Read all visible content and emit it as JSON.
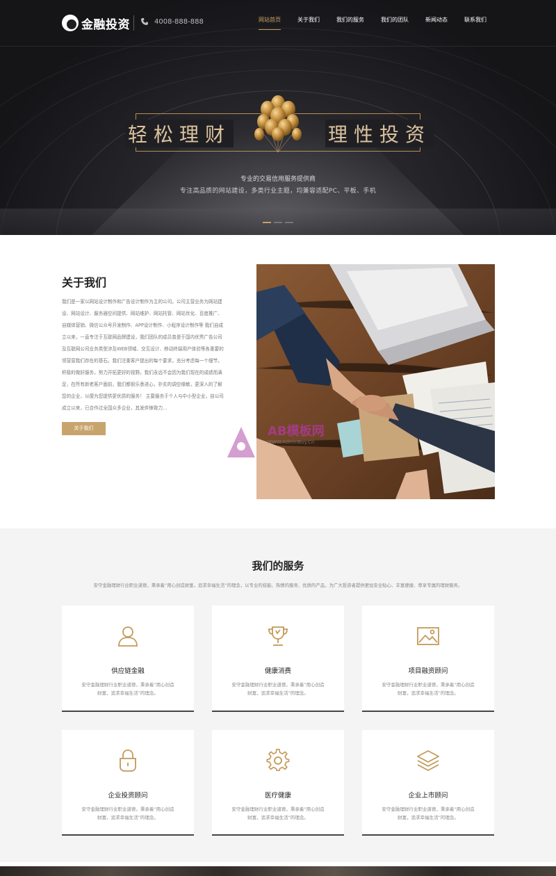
{
  "header": {
    "logo_text": "金融投资",
    "phone": "4008-888-888",
    "nav": [
      {
        "label": "网站首页",
        "active": true
      },
      {
        "label": "关于我们",
        "active": false
      },
      {
        "label": "我们的服务",
        "active": false
      },
      {
        "label": "我们的团队",
        "active": false
      },
      {
        "label": "新闻动态",
        "active": false
      },
      {
        "label": "联系我们",
        "active": false
      }
    ]
  },
  "hero": {
    "headline_left": "轻松理财",
    "headline_right": "理性投资",
    "sub1": "专业的交易信用服务提供商",
    "sub2": "专注高品质的网站建设，多类行业主题，均兼容适配PC、平板、手机",
    "slides": 3,
    "active_slide": 0
  },
  "about": {
    "title": "关于我们",
    "text": "我们是一家以网站设计制作和广告设计制作为主的公司。公司主营业务为网站建设、网站设计、服务器空间提供、网站维护、网站托管、网站优化、百度推广、自媒体营销、微信公众号开发制作、APP设计制作、小程序设计制作等 我们自成立以来，一直专注于互联网品牌建设，我们团队的成员曾是于国内优秀广告公司及互联网公司业务类型涉及WEB领域、交互设计、移动终端用户体验等各重要的领营营我们存在的基石。我们注重客户提出的每个要求，充分考虑每一个细节，积极的做好服务，努力开拓更好的视野。我们永远不会因为我们现在的成绩而满足，在所有新老客户面前，我们都很乐意进心，扑实的调空缘敏，更深入的了解您的企业，以便为您提供更优质的服务！ 主要服务于个人与中小型企业，自公司成立以来，已合作过全国众多企业，其发伴锋致力...",
    "button": "关于我们",
    "watermark_main": "AB模板网",
    "watermark_sub": "WWW.AdminBuy.Cn"
  },
  "services": {
    "title": "我们的服务",
    "desc": "安守金融理财行业职业道德，秉承着“用心创造财富，追求幸福生活”的理念，以专业的技能、热情的服务、优质的产品，为广大投资者提供更加安全贴心、丰富便捷、尊享专属的理财服务。",
    "items": [
      {
        "name": "供应链金融",
        "text": "安守金融理财行业职业道德，秉承着“用心创造财富，追求幸福生活”的理念。",
        "icon": "user-icon"
      },
      {
        "name": "健康消费",
        "text": "安守金融理财行业职业道德，秉承着“用心创造财富，追求幸福生活”的理念。",
        "icon": "trophy-icon"
      },
      {
        "name": "项目融资顾问",
        "text": "安守金融理财行业职业道德，秉承着“用心创造财富，追求幸福生活”的理念。",
        "icon": "image-icon"
      },
      {
        "name": "企业投资顾问",
        "text": "安守金融理财行业职业道德，秉承着“用心创造财富，追求幸福生活”的理念。",
        "icon": "lock-icon"
      },
      {
        "name": "医疗健康",
        "text": "安守金融理财行业职业道德，秉承着“用心创造财富，追求幸福生活”的理念。",
        "icon": "gear-icon"
      },
      {
        "name": "企业上市顾问",
        "text": "安守金融理财行业职业道德，秉承着“用心创造财富，追求幸福生活”的理念。",
        "icon": "layers-icon"
      }
    ]
  },
  "colors": {
    "accent": "#c9a063",
    "dark": "#1d1d21",
    "gray_bg": "#f4f4f4"
  }
}
